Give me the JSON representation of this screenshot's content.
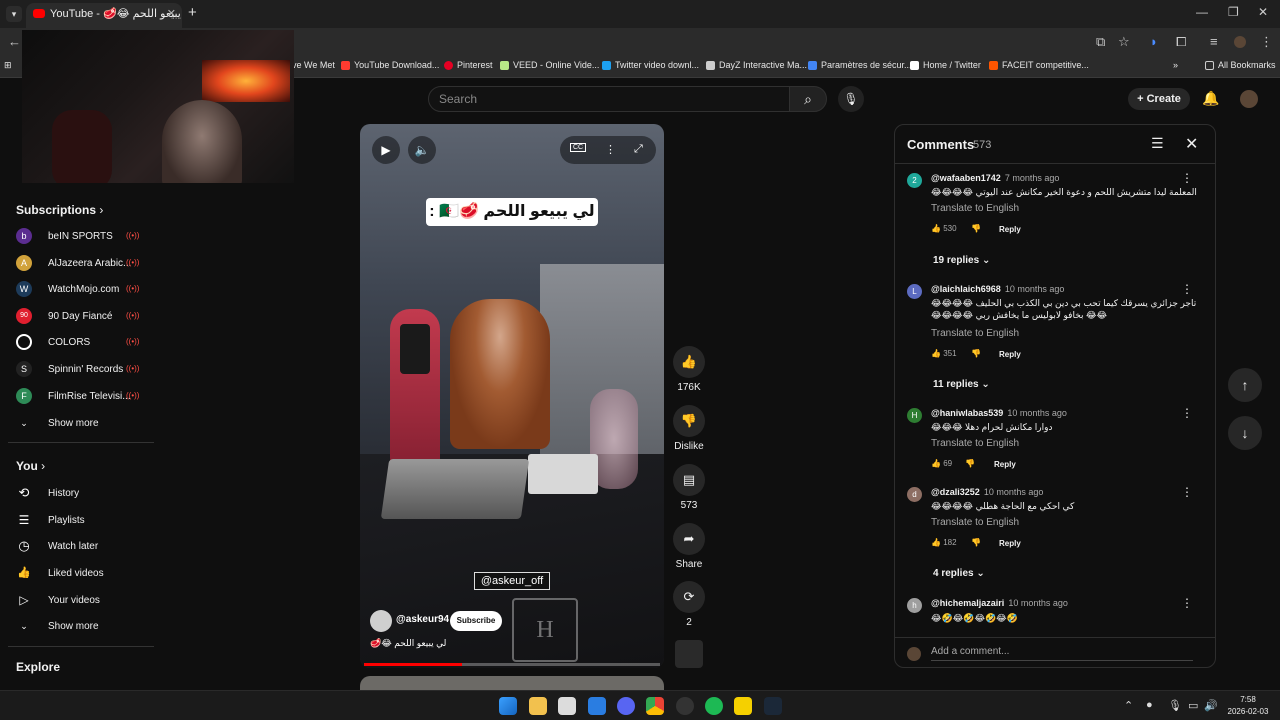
{
  "browser": {
    "tab_title": "YouTube - 🥩😂 لي يبيعو اللحم",
    "tab_close": "✕",
    "new_tab": "+",
    "window_controls": [
      "—",
      "❐",
      "✕"
    ]
  },
  "bookmarks": {
    "items": [
      {
        "label": "ve We Met",
        "color": "#888888"
      },
      {
        "label": "YouTube Download...",
        "color": "#ff3b30"
      },
      {
        "label": "Pinterest",
        "color": "#e60023"
      },
      {
        "label": "VEED - Online Vide...",
        "color": "#b8e986"
      },
      {
        "label": "Twitter video downl...",
        "color": "#1da1f2"
      },
      {
        "label": "DayZ Interactive Ma...",
        "color": "#cccccc"
      },
      {
        "label": "Paramètres de sécur...",
        "color": "#4285f4"
      },
      {
        "label": "Home / Twitter",
        "color": "#ffffff"
      },
      {
        "label": "FACEIT competitive...",
        "color": "#ff5500"
      }
    ],
    "all_label": "All Bookmarks"
  },
  "youtube": {
    "search_placeholder": "Search",
    "create_label": "Create"
  },
  "sidebar": {
    "subscriptions_title": "Subscriptions",
    "subscriptions": [
      {
        "label": "beIN SPORTS",
        "color": "#5b2d90",
        "initial": "b"
      },
      {
        "label": "AlJazeera Arabic...",
        "color": "#d1a23b",
        "initial": "A"
      },
      {
        "label": "WatchMojo.com",
        "color": "#1d3b5a",
        "initial": "W"
      },
      {
        "label": "90 Day Fiancé",
        "color": "#e01f2f",
        "initial": "90"
      },
      {
        "label": "COLORS",
        "color": "#ffffff",
        "initial": "O"
      },
      {
        "label": "Spinnin' Records",
        "color": "#222222",
        "initial": "S"
      },
      {
        "label": "FilmRise Televisi...",
        "color": "#2e8b57",
        "initial": "F"
      }
    ],
    "live_indicator": "((•))",
    "show_more_1": "Show more",
    "you_title": "You",
    "you_items": [
      {
        "label": "History",
        "icon": "⟲"
      },
      {
        "label": "Playlists",
        "icon": "☰"
      },
      {
        "label": "Watch later",
        "icon": "◷"
      },
      {
        "label": "Liked videos",
        "icon": "👍"
      },
      {
        "label": "Your videos",
        "icon": "▷"
      }
    ],
    "show_more_2": "Show more",
    "explore_title": "Explore"
  },
  "video": {
    "caption": "لي يبيعو اللحم 🥩🇩🇿 :",
    "handle_overlay": "@askeur_off",
    "channel": "@askeur94",
    "subscribe_label": "Subscribe",
    "title": "لي يبيعو اللحم 😂🥩",
    "progress": 0.33,
    "watermark": "H"
  },
  "actions": {
    "like_count": "176K",
    "dislike_label": "Dislike",
    "comment_count": "573",
    "share_label": "Share",
    "remix_count": "2"
  },
  "comments": {
    "title": "Comments",
    "count": "573",
    "translate_label": "Translate to English",
    "reply_label": "Reply",
    "add_placeholder": "Add a comment...",
    "items": [
      {
        "avatar": "2",
        "color": "#1fa89a",
        "author": "@wafaaben1742",
        "ago": "7 months ago",
        "text": "المعلمة ليدا متشريش اللحم و دعوة الخير مكانش عند اليوتي 😂😂😂😂",
        "likes": "530",
        "replies": "19 replies"
      },
      {
        "avatar": "L",
        "color": "#5c6bc0",
        "author": "@laichlaich6968",
        "ago": "10 months ago",
        "text": "تاجر جزائري يسرقك كيما تحب بي دين  بي الكذب بي الحليف 😂😂😂😂😂😂 بخافو لابوليس  ما يخافش ربي 😂😂😂😂",
        "likes": "351",
        "replies": "11 replies"
      },
      {
        "avatar": "H",
        "color": "#2e7d32",
        "author": "@haniwlabas539",
        "ago": "10 months ago",
        "text": "دوارا  مكانش لحرام دهلا 😂😂😂",
        "likes": "69",
        "replies": ""
      },
      {
        "avatar": "d",
        "color": "#8d6e63",
        "author": "@dzali3252",
        "ago": "10 months ago",
        "text": "كي احكي مع الحاجة هطلي 😂😂😂😂",
        "likes": "182",
        "replies": "4 replies"
      },
      {
        "avatar": "h",
        "color": "#9e9e9e",
        "author": "@hichemaljazairi",
        "ago": "10 months ago",
        "text": "🤣😂🤣😂🤣😂🤣😂",
        "likes": "",
        "replies": ""
      }
    ]
  },
  "taskbar": {
    "time": "7:58",
    "date": "2026-02-03"
  }
}
